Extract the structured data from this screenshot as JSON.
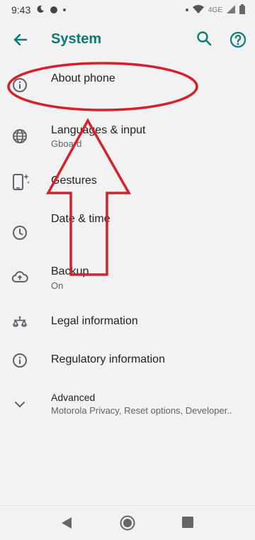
{
  "status_bar": {
    "time": "9:43",
    "network": "4GE"
  },
  "app_bar": {
    "title": "System"
  },
  "colors": {
    "accent": "#0b7a76",
    "annotation": "#d8202a",
    "background": "#f2f2f2"
  },
  "items": [
    {
      "label": "About phone",
      "icon": "info-icon"
    },
    {
      "label": "Languages & input",
      "sub": "Gboard",
      "icon": "globe-icon"
    },
    {
      "label": "Gestures",
      "icon": "gestures-phone-icon"
    },
    {
      "label": "Date & time",
      "icon": "clock-icon"
    },
    {
      "label": "Backup",
      "sub": "On",
      "icon": "cloud-upload-icon"
    },
    {
      "label": "Legal information",
      "icon": "scales-icon"
    },
    {
      "label": "Regulatory information",
      "icon": "info-icon"
    },
    {
      "label": "Advanced",
      "sub": "Motorola Privacy, Reset options, Developer..",
      "icon": "chevron-down-icon"
    }
  ]
}
